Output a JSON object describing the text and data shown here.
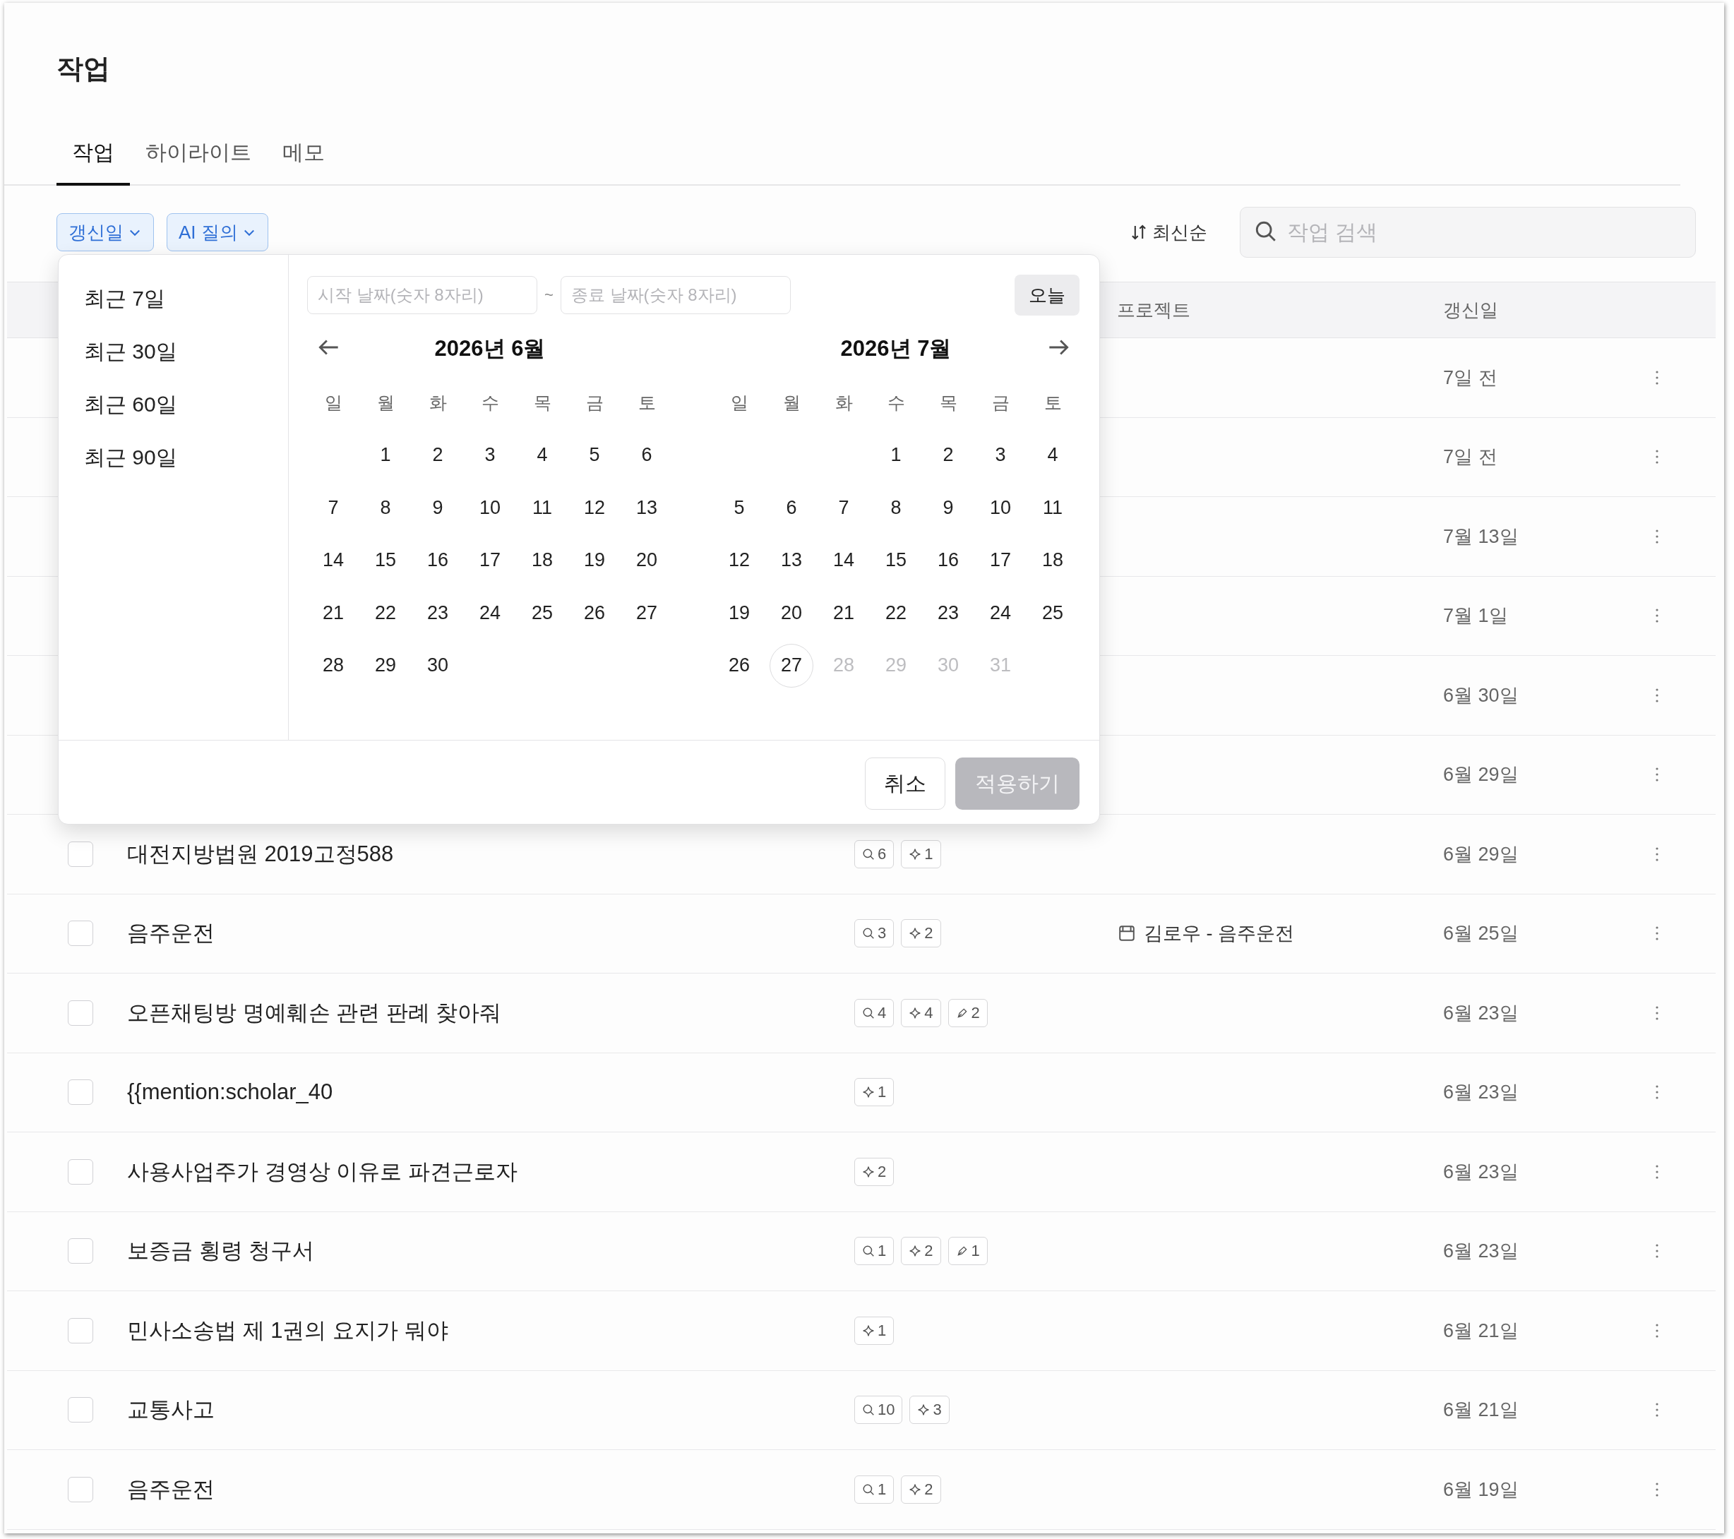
{
  "page_title": "작업",
  "tabs": [
    {
      "label": "작업",
      "selected": true
    },
    {
      "label": "하이라이트",
      "selected": false
    },
    {
      "label": "메모",
      "selected": false
    }
  ],
  "filters": [
    {
      "label": "갱신일"
    },
    {
      "label": "AI 질의"
    }
  ],
  "sort": {
    "label": "최신순"
  },
  "search": {
    "placeholder": "작업 검색"
  },
  "table": {
    "columns": [
      {
        "kind": "project",
        "label": "프로젝트"
      },
      {
        "kind": "date",
        "label": "갱신일"
      }
    ],
    "rows": [
      {
        "date": "7일 전"
      },
      {
        "date": "7일 전"
      },
      {
        "date": "7월 13일"
      },
      {
        "date": "7월 1일"
      },
      {
        "date": "6월 30일"
      },
      {
        "date": "6월 29일"
      },
      {
        "checked": false,
        "title": "대전지방법원 2019고정588",
        "badges": [
          {
            "kind": "search",
            "count": "6"
          },
          {
            "kind": "sparkle",
            "count": "1"
          }
        ],
        "date": "6월 29일"
      },
      {
        "checked": false,
        "title": "음주운전",
        "badges": [
          {
            "kind": "search",
            "count": "3"
          },
          {
            "kind": "sparkle",
            "count": "2"
          }
        ],
        "project": "김로우 - 음주운전",
        "date": "6월 25일"
      },
      {
        "checked": false,
        "title": "오픈채팅방 명예훼손 관련 판례 찾아줘",
        "badges": [
          {
            "kind": "search",
            "count": "4"
          },
          {
            "kind": "sparkle",
            "count": "4"
          },
          {
            "kind": "pen",
            "count": "2"
          }
        ],
        "date": "6월 23일"
      },
      {
        "checked": false,
        "title": "{{mention:scholar_40",
        "badges": [
          {
            "kind": "sparkle",
            "count": "1"
          }
        ],
        "date": "6월 23일"
      },
      {
        "checked": false,
        "title": "사용사업주가 경영상 이유로 파견근로자",
        "badges": [
          {
            "kind": "sparkle",
            "count": "2"
          }
        ],
        "date": "6월 23일"
      },
      {
        "checked": false,
        "title": "보증금 횡령 청구서",
        "badges": [
          {
            "kind": "search",
            "count": "1"
          },
          {
            "kind": "sparkle",
            "count": "2"
          },
          {
            "kind": "pen",
            "count": "1"
          }
        ],
        "date": "6월 23일"
      },
      {
        "checked": false,
        "title": "민사소송법 제 1권의 요지가 뭐야",
        "badges": [
          {
            "kind": "sparkle",
            "count": "1"
          }
        ],
        "date": "6월 21일"
      },
      {
        "checked": false,
        "title": "교통사고",
        "badges": [
          {
            "kind": "search",
            "count": "10"
          },
          {
            "kind": "sparkle",
            "count": "3"
          }
        ],
        "date": "6월 21일"
      },
      {
        "checked": false,
        "title": "음주운전",
        "badges": [
          {
            "kind": "search",
            "count": "1"
          },
          {
            "kind": "sparkle",
            "count": "2"
          }
        ],
        "date": "6월 19일"
      }
    ]
  },
  "date_picker": {
    "presets": [
      {
        "label": "최근 7일"
      },
      {
        "label": "최근 30일"
      },
      {
        "label": "최근 60일"
      },
      {
        "label": "최근 90일"
      }
    ],
    "start_field": {
      "placeholder": "시작 날짜(숫자 8자리)"
    },
    "separator": "~",
    "end_field": {
      "placeholder": "종료 날짜(숫자 8자리)"
    },
    "today_button": "오늘",
    "months": [
      {
        "title": "2026년 6월",
        "kind": "prev",
        "weekdays": [
          "일",
          "월",
          "화",
          "수",
          "목",
          "금",
          "토"
        ],
        "days": [
          {
            "kind": "blank"
          },
          {
            "kind": "day",
            "label": "1",
            "today": false,
            "disabled": false
          },
          {
            "kind": "day",
            "label": "2",
            "today": false,
            "disabled": false
          },
          {
            "kind": "day",
            "label": "3",
            "today": false,
            "disabled": false
          },
          {
            "kind": "day",
            "label": "4",
            "today": false,
            "disabled": false
          },
          {
            "kind": "day",
            "label": "5",
            "today": false,
            "disabled": false
          },
          {
            "kind": "day",
            "label": "6",
            "today": false,
            "disabled": false
          },
          {
            "kind": "day",
            "label": "7",
            "today": false,
            "disabled": false
          },
          {
            "kind": "day",
            "label": "8",
            "today": false,
            "disabled": false
          },
          {
            "kind": "day",
            "label": "9",
            "today": false,
            "disabled": false
          },
          {
            "kind": "day",
            "label": "10",
            "today": false,
            "disabled": false
          },
          {
            "kind": "day",
            "label": "11",
            "today": false,
            "disabled": false
          },
          {
            "kind": "day",
            "label": "12",
            "today": false,
            "disabled": false
          },
          {
            "kind": "day",
            "label": "13",
            "today": false,
            "disabled": false
          },
          {
            "kind": "day",
            "label": "14",
            "today": false,
            "disabled": false
          },
          {
            "kind": "day",
            "label": "15",
            "today": false,
            "disabled": false
          },
          {
            "kind": "day",
            "label": "16",
            "today": false,
            "disabled": false
          },
          {
            "kind": "day",
            "label": "17",
            "today": false,
            "disabled": false
          },
          {
            "kind": "day",
            "label": "18",
            "today": false,
            "disabled": false
          },
          {
            "kind": "day",
            "label": "19",
            "today": false,
            "disabled": false
          },
          {
            "kind": "day",
            "label": "20",
            "today": false,
            "disabled": false
          },
          {
            "kind": "day",
            "label": "21",
            "today": false,
            "disabled": false
          },
          {
            "kind": "day",
            "label": "22",
            "today": false,
            "disabled": false
          },
          {
            "kind": "day",
            "label": "23",
            "today": false,
            "disabled": false
          },
          {
            "kind": "day",
            "label": "24",
            "today": false,
            "disabled": false
          },
          {
            "kind": "day",
            "label": "25",
            "today": false,
            "disabled": false
          },
          {
            "kind": "day",
            "label": "26",
            "today": false,
            "disabled": false
          },
          {
            "kind": "day",
            "label": "27",
            "today": false,
            "disabled": false
          },
          {
            "kind": "day",
            "label": "28",
            "today": false,
            "disabled": false
          },
          {
            "kind": "day",
            "label": "29",
            "today": false,
            "disabled": false
          },
          {
            "kind": "day",
            "label": "30",
            "today": false,
            "disabled": false
          }
        ]
      },
      {
        "title": "2026년 7월",
        "kind": "next",
        "weekdays": [
          "일",
          "월",
          "화",
          "수",
          "목",
          "금",
          "토"
        ],
        "days": [
          {
            "kind": "blank"
          },
          {
            "kind": "blank"
          },
          {
            "kind": "blank"
          },
          {
            "kind": "day",
            "label": "1",
            "today": false,
            "disabled": false
          },
          {
            "kind": "day",
            "label": "2",
            "today": false,
            "disabled": false
          },
          {
            "kind": "day",
            "label": "3",
            "today": false,
            "disabled": false
          },
          {
            "kind": "day",
            "label": "4",
            "today": false,
            "disabled": false
          },
          {
            "kind": "day",
            "label": "5",
            "today": false,
            "disabled": false
          },
          {
            "kind": "day",
            "label": "6",
            "today": false,
            "disabled": false
          },
          {
            "kind": "day",
            "label": "7",
            "today": false,
            "disabled": false
          },
          {
            "kind": "day",
            "label": "8",
            "today": false,
            "disabled": false
          },
          {
            "kind": "day",
            "label": "9",
            "today": false,
            "disabled": false
          },
          {
            "kind": "day",
            "label": "10",
            "today": false,
            "disabled": false
          },
          {
            "kind": "day",
            "label": "11",
            "today": false,
            "disabled": false
          },
          {
            "kind": "day",
            "label": "12",
            "today": false,
            "disabled": false
          },
          {
            "kind": "day",
            "label": "13",
            "today": false,
            "disabled": false
          },
          {
            "kind": "day",
            "label": "14",
            "today": false,
            "disabled": false
          },
          {
            "kind": "day",
            "label": "15",
            "today": false,
            "disabled": false
          },
          {
            "kind": "day",
            "label": "16",
            "today": false,
            "disabled": false
          },
          {
            "kind": "day",
            "label": "17",
            "today": false,
            "disabled": false
          },
          {
            "kind": "day",
            "label": "18",
            "today": false,
            "disabled": false
          },
          {
            "kind": "day",
            "label": "19",
            "today": false,
            "disabled": false
          },
          {
            "kind": "day",
            "label": "20",
            "today": false,
            "disabled": false
          },
          {
            "kind": "day",
            "label": "21",
            "today": false,
            "disabled": false
          },
          {
            "kind": "day",
            "label": "22",
            "today": false,
            "disabled": false
          },
          {
            "kind": "day",
            "label": "23",
            "today": false,
            "disabled": false
          },
          {
            "kind": "day",
            "label": "24",
            "today": false,
            "disabled": false
          },
          {
            "kind": "day",
            "label": "25",
            "today": false,
            "disabled": false
          },
          {
            "kind": "day",
            "label": "26",
            "today": false,
            "disabled": false
          },
          {
            "kind": "day",
            "label": "27",
            "today": true,
            "disabled": false
          },
          {
            "kind": "day",
            "label": "28",
            "today": false,
            "disabled": true
          },
          {
            "kind": "day",
            "label": "29",
            "today": false,
            "disabled": true
          },
          {
            "kind": "day",
            "label": "30",
            "today": false,
            "disabled": true
          },
          {
            "kind": "day",
            "label": "31",
            "today": false,
            "disabled": true
          }
        ]
      }
    ],
    "cancel_button": "취소",
    "apply_button": {
      "label": "적용하기",
      "disabled": true
    }
  }
}
